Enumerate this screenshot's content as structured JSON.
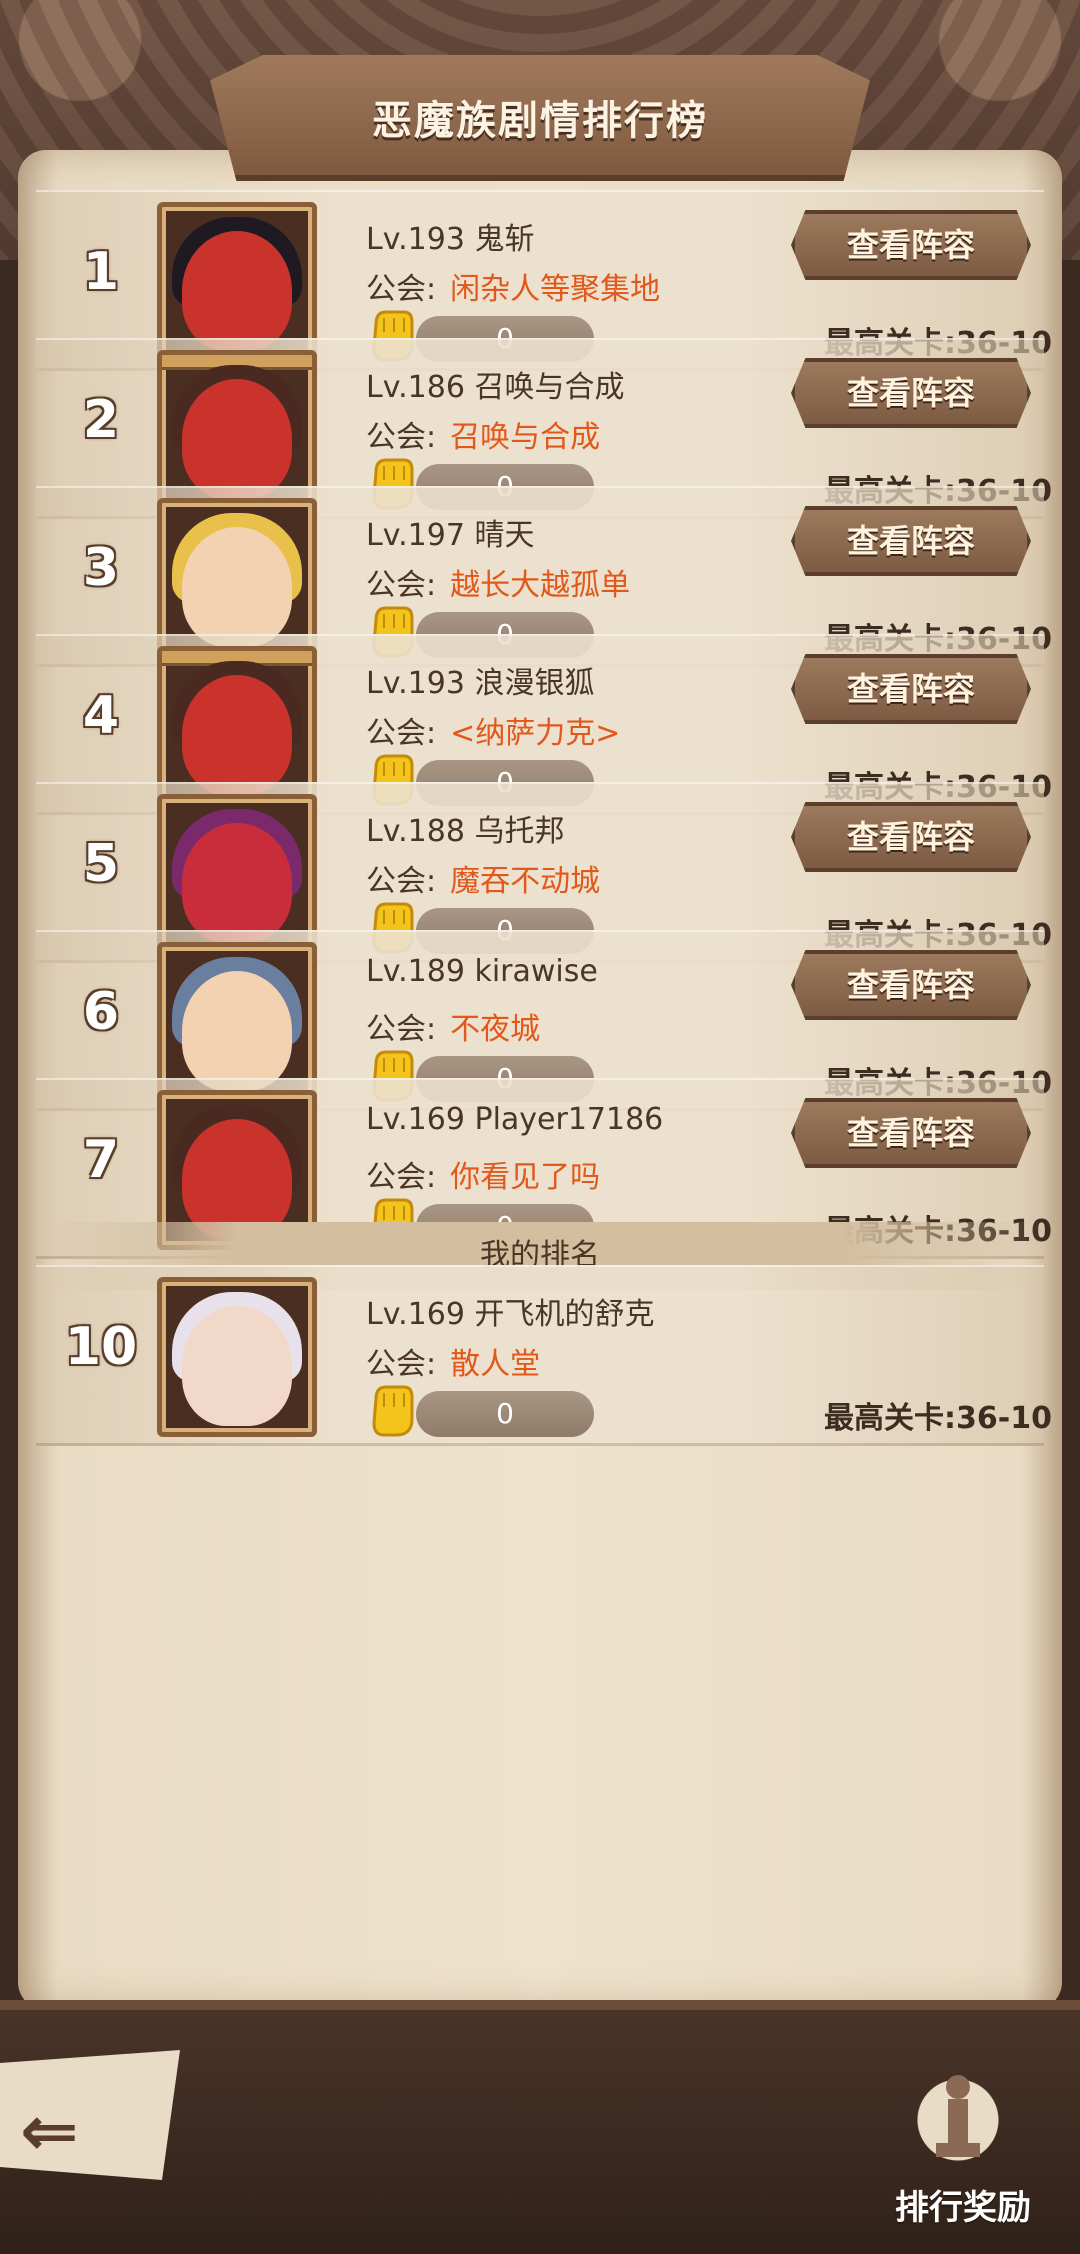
{
  "title": "恶魔族剧情排行榜",
  "guild_prefix": "公会:",
  "view_button_label": "查看阵容",
  "stage_prefix": "最高关卡:",
  "entries": [
    {
      "rank": "1",
      "level_name": "Lv.193 鬼斩",
      "guild": "闲杂人等聚集地",
      "score": "0",
      "stage": "36-10",
      "avatar_hair": "#1f1a22",
      "avatar_skin": "#c9332c",
      "pillar": false
    },
    {
      "rank": "2",
      "level_name": "Lv.186 召唤与合成",
      "guild": "召唤与合成",
      "score": "0",
      "stage": "36-10",
      "avatar_hair": "#4a2a20",
      "avatar_skin": "#c9332c",
      "pillar": true
    },
    {
      "rank": "3",
      "level_name": "Lv.197 晴天",
      "guild": "越长大越孤单",
      "score": "0",
      "stage": "36-10",
      "avatar_hair": "#e8c04a",
      "avatar_skin": "#f2d2b0",
      "pillar": false
    },
    {
      "rank": "4",
      "level_name": "Lv.193 浪漫银狐",
      "guild": "<纳萨力克>",
      "score": "0",
      "stage": "36-10",
      "avatar_hair": "#4a2a20",
      "avatar_skin": "#c9332c",
      "pillar": true
    },
    {
      "rank": "5",
      "level_name": "Lv.188 乌托邦",
      "guild": "魔吞不动城",
      "score": "0",
      "stage": "36-10",
      "avatar_hair": "#7a2a6a",
      "avatar_skin": "#c92c3a",
      "pillar": false
    },
    {
      "rank": "6",
      "level_name": "Lv.189 kirawise",
      "guild": "不夜城",
      "score": "0",
      "stage": "36-10",
      "avatar_hair": "#6a7ea0",
      "avatar_skin": "#f2d2b0",
      "pillar": false
    },
    {
      "rank": "7",
      "level_name": "Lv.169 Player17186",
      "guild": "你看见了吗",
      "score": "0",
      "stage": "36-10",
      "avatar_hair": "#4a2a20",
      "avatar_skin": "#c9332c",
      "pillar": false
    }
  ],
  "my_rank_label": "我的排名",
  "my_entry": {
    "rank": "10",
    "level_name": "Lv.169 开飞机的舒克",
    "guild": "散人堂",
    "score": "0",
    "stage": "36-10",
    "avatar_hair": "#e8e0ea",
    "avatar_skin": "#f2d8c8"
  },
  "reward_label": "排行奖励",
  "colors": {
    "guild_name": "#e2581a",
    "accent_brown": "#7d5b43"
  }
}
